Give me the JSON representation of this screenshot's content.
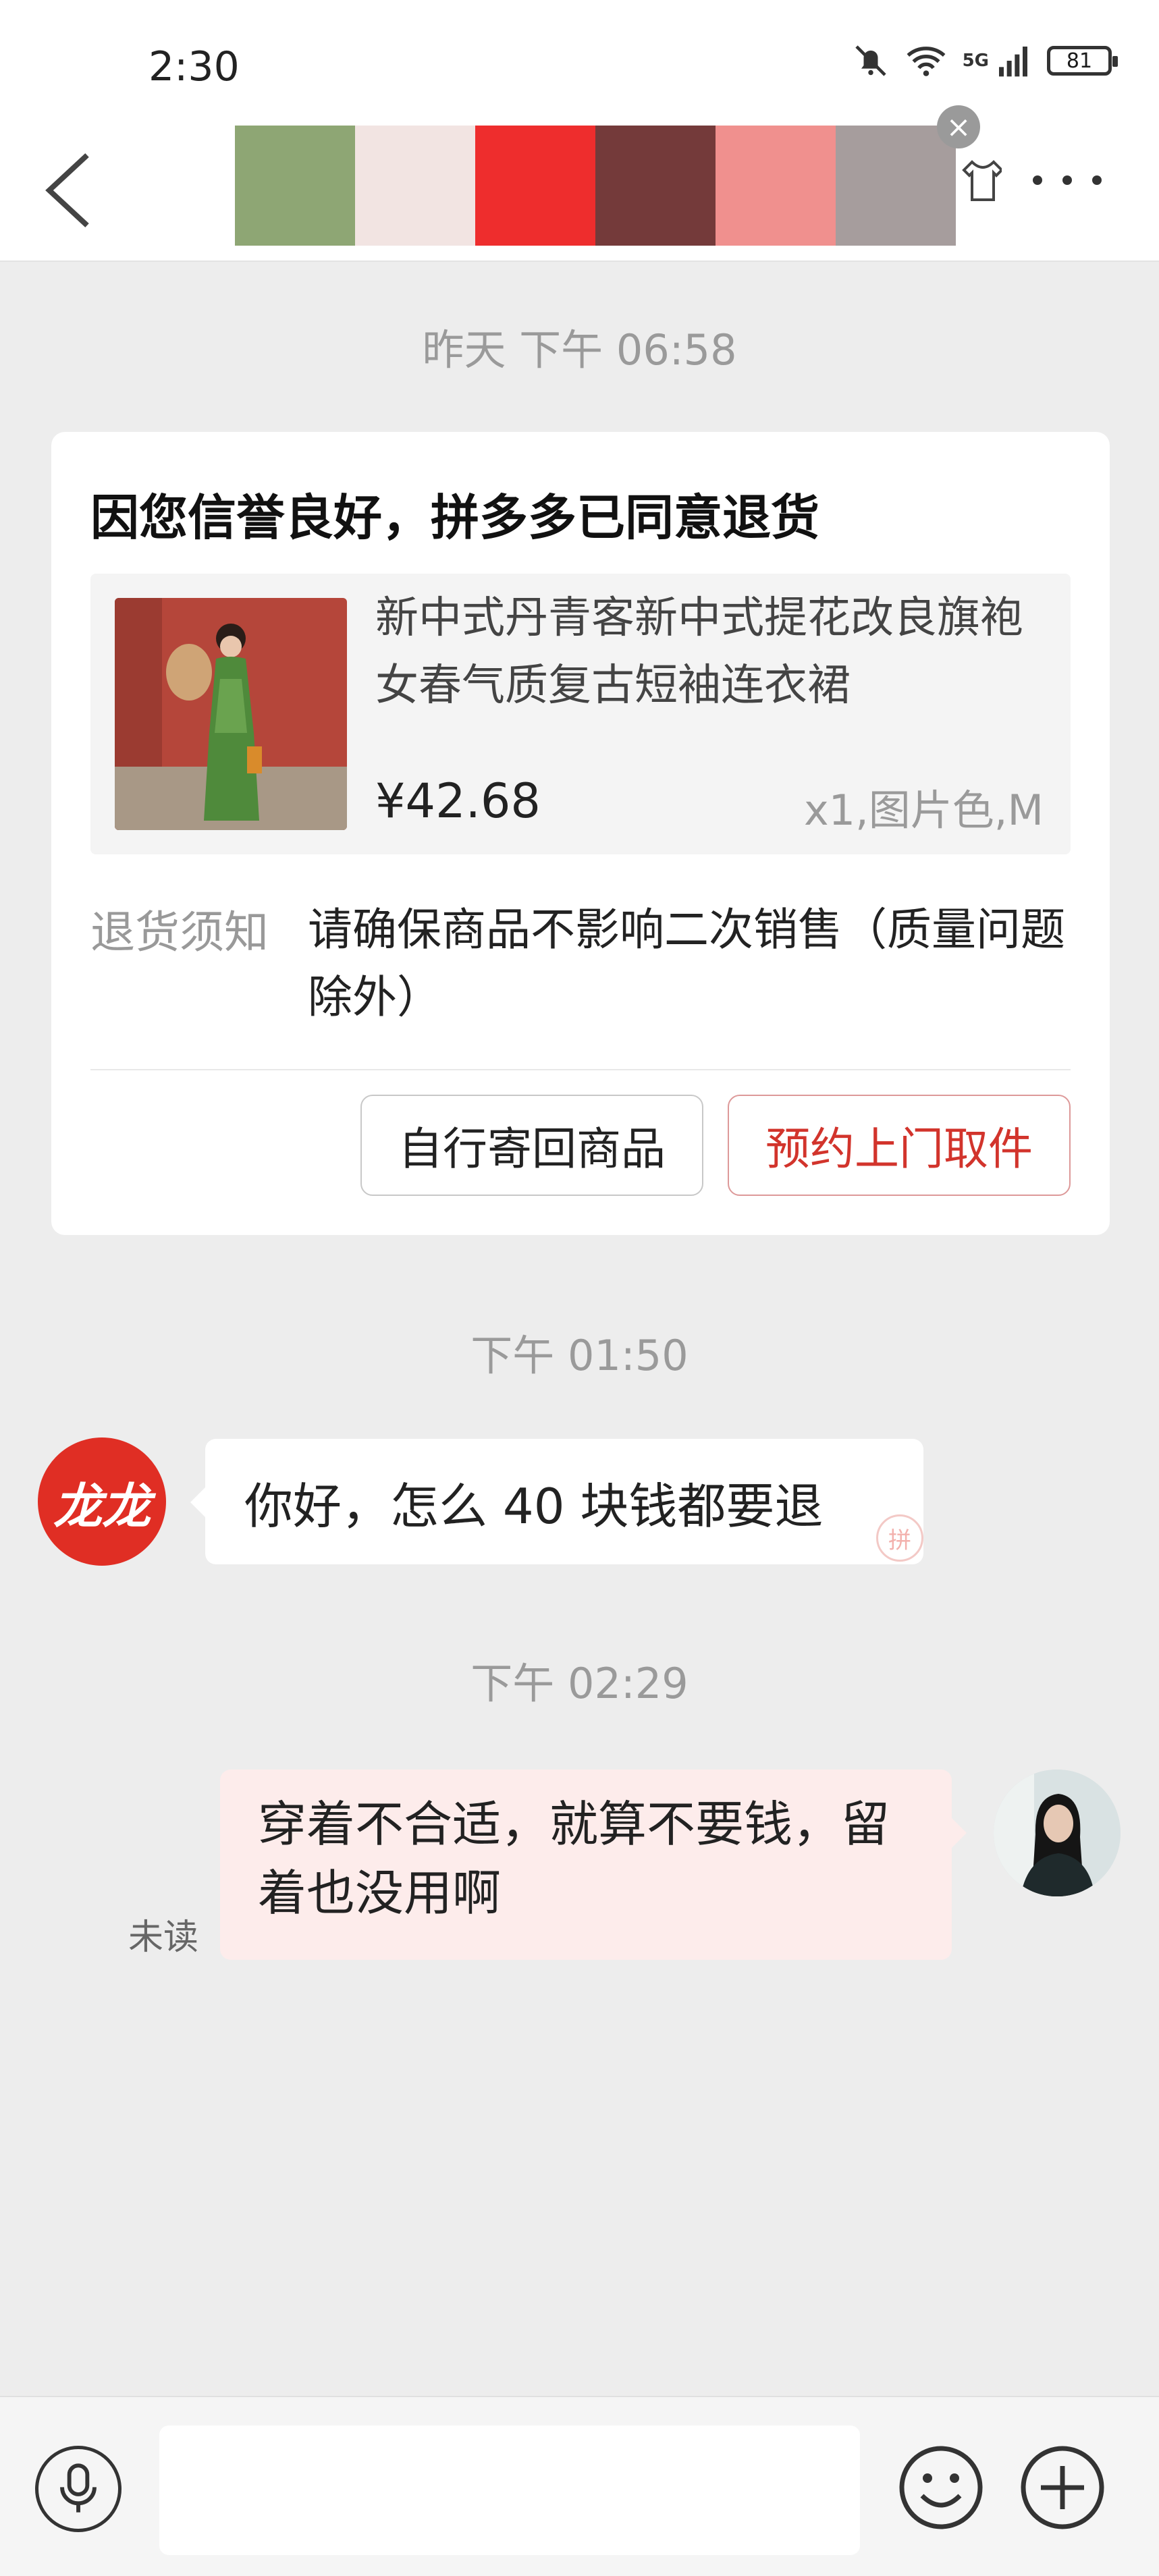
{
  "status": {
    "time": "2:30",
    "network": "5G",
    "battery": "81"
  },
  "palette": {
    "colors": [
      "#8ea674",
      "#f2e4e2",
      "#ee2d2d",
      "#743a3a",
      "#f0908e",
      "#a69d9d"
    ]
  },
  "messages": {
    "ts1": "昨天 下午 06:58",
    "card": {
      "title": "因您信誉良好，拼多多已同意退货",
      "product_name": "新中式丹青客新中式提花改良旗袍女春气质复古短袖连衣裙",
      "price": "¥42.68",
      "spec": "x1,图片色,M",
      "notice_label": "退货须知",
      "notice_text": "请确保商品不影响二次销售（质量问题除外）",
      "btn_self": "自行寄回商品",
      "btn_pickup": "预约上门取件"
    },
    "ts2": "下午 01:50",
    "shop_avatar": "龙龙",
    "shop_msg": "你好，怎么 40 块钱都要退",
    "pdd_mark": "拼",
    "ts3": "下午 02:29",
    "user_msg": "穿着不合适，就算不要钱，留着也没用啊",
    "unread": "未读"
  },
  "input": {
    "placeholder": ""
  }
}
